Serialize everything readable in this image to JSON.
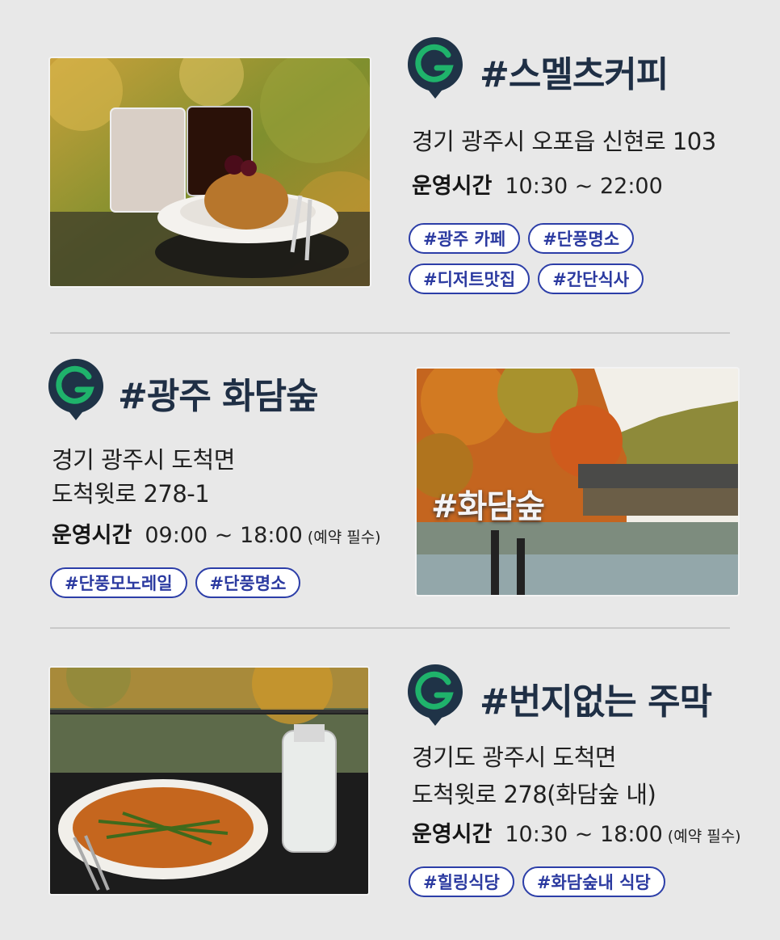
{
  "sections": [
    {
      "title": "#스멜츠커피",
      "address_lines": [
        "경기 광주시 오포읍 신현로 103"
      ],
      "hours_label": "운영시간",
      "hours": "10:30 ~ 22:00",
      "hours_note": "",
      "tags": [
        "#광주 카페",
        "#단풍명소",
        "#디저트맛집",
        "#간단식사"
      ],
      "photo_icon": "coffee-dessert-photo"
    },
    {
      "title": "#광주 화담숲",
      "address_lines": [
        "경기 광주시 도척면",
        "도척윗로 278-1"
      ],
      "hours_label": "운영시간",
      "hours": "09:00 ~ 18:00",
      "hours_note": "(예약 필수)",
      "tags": [
        "#단풍모노레일",
        "#단풍명소"
      ],
      "photo_sign": "#화담숲",
      "photo_icon": "autumn-lake-photo"
    },
    {
      "title": "#번지없는 주막",
      "address_lines": [
        "경기도 광주시 도척면",
        "도척윗로 278(화담숲 내)"
      ],
      "hours_label": "운영시간",
      "hours": "10:30 ~ 18:00",
      "hours_note": "(예약 필수)",
      "tags": [
        "#힐링식당",
        "#화담숲내 식당"
      ],
      "photo_icon": "pancake-drink-photo"
    }
  ],
  "colors": {
    "background": "#e8e8e8",
    "title": "#1f2f45",
    "tag_border": "#2c3ea8",
    "logo_dark": "#1f3347",
    "logo_green": "#1fb36b"
  },
  "logo_icon": "g-pin-logo-icon"
}
